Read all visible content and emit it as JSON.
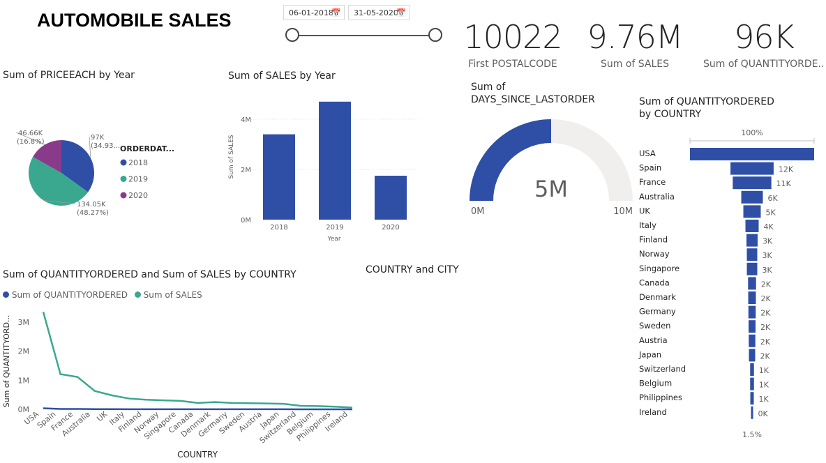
{
  "title": "AUTOMOBILE SALES",
  "date_filter": {
    "start": "06-01-2018",
    "end": "31-05-2020",
    "calendar_icon": "calendar-icon"
  },
  "cards": [
    {
      "value": "10022",
      "label": "First POSTALCODE"
    },
    {
      "value": "9.76M",
      "label": "Sum of SALES"
    },
    {
      "value": "96K",
      "label": "Sum of QUANTITYORDE..."
    }
  ],
  "colors": {
    "blue": "#2f4fa6",
    "teal": "#3aa88f",
    "purple": "#8a3a8a",
    "gauge_bg": "#f0efee"
  },
  "texts": {
    "country_city_title": "COUNTRY and CITY"
  },
  "chart_data": [
    {
      "type": "pie",
      "title": "Sum of PRICEEACH by Year",
      "legend_title": "ORDERDAT...",
      "legend_position": "right",
      "slices": [
        {
          "name": "2018",
          "value": 97,
          "label": "97K",
          "pct_label": "(34.93...",
          "color": "#2f4fa6"
        },
        {
          "name": "2019",
          "value": 134.05,
          "label": "134.05K",
          "pct_label": "(48.27%)",
          "color": "#3aa88f"
        },
        {
          "name": "2020",
          "value": 46.66,
          "label": "46.66K",
          "pct_label": "(16.8%)",
          "color": "#8a3a8a"
        }
      ]
    },
    {
      "type": "bar",
      "title": "Sum of SALES by Year",
      "categories": [
        "2018",
        "2019",
        "2020"
      ],
      "values": [
        3.4,
        4.7,
        1.75
      ],
      "xlabel": "Year",
      "ylabel": "Sum of SALES",
      "yticks": [
        "0M",
        "2M",
        "4M"
      ],
      "ylim": [
        0,
        5
      ]
    },
    {
      "type": "gauge",
      "title": "Sum of DAYS_SINCE_LASTORDER",
      "value": 5,
      "value_label": "5M",
      "min_label": "0M",
      "max_label": "10M",
      "min": 0,
      "max": 10
    },
    {
      "type": "bar",
      "orientation": "horizontal-funnel",
      "title": "Sum of QUANTITYORDERED by COUNTRY",
      "top_label": "100%",
      "bottom_label": "1.5%",
      "categories": [
        "USA",
        "Spain",
        "France",
        "Australia",
        "UK",
        "Italy",
        "Finland",
        "Norway",
        "Singapore",
        "Canada",
        "Denmark",
        "Germany",
        "Sweden",
        "Austria",
        "Japan",
        "Switzerland",
        "Belgium",
        "Philippines",
        "Ireland"
      ],
      "values": [
        35.7,
        12.4,
        11.1,
        6.2,
        5.0,
        3.8,
        3.2,
        3.0,
        3.0,
        2.3,
        2.2,
        2.1,
        2.0,
        1.9,
        1.8,
        1.1,
        1.1,
        1.0,
        0.5
      ],
      "data_labels": [
        "",
        "12K",
        "11K",
        "6K",
        "5K",
        "4K",
        "3K",
        "3K",
        "3K",
        "2K",
        "2K",
        "2K",
        "2K",
        "2K",
        "2K",
        "1K",
        "1K",
        "1K",
        "0K"
      ]
    },
    {
      "type": "line",
      "title": "Sum of QUANTITYORDERED and Sum of SALES by COUNTRY",
      "xlabel": "COUNTRY",
      "ylabel": "Sum of QUANTITYORD...",
      "yticks": [
        "0M",
        "1M",
        "2M",
        "3M"
      ],
      "ylim": [
        0,
        3.5
      ],
      "legend_position": "top-left",
      "categories": [
        "USA",
        "Spain",
        "France",
        "Australia",
        "UK",
        "Italy",
        "Finland",
        "Norway",
        "Singapore",
        "Canada",
        "Denmark",
        "Germany",
        "Sweden",
        "Austria",
        "Japan",
        "Switzerland",
        "Belgium",
        "Philippines",
        "Ireland"
      ],
      "series": [
        {
          "name": "Sum of QUANTITYORDERED",
          "color": "#2f4fa6",
          "values": [
            0.036,
            0.012,
            0.011,
            0.006,
            0.005,
            0.004,
            0.003,
            0.003,
            0.003,
            0.002,
            0.002,
            0.002,
            0.002,
            0.002,
            0.002,
            0.001,
            0.001,
            0.001,
            0.0005
          ]
        },
        {
          "name": "Sum of SALES",
          "color": "#3aa88f",
          "values": [
            3.35,
            1.21,
            1.11,
            0.63,
            0.48,
            0.37,
            0.33,
            0.31,
            0.29,
            0.22,
            0.25,
            0.22,
            0.21,
            0.2,
            0.19,
            0.12,
            0.11,
            0.09,
            0.06
          ]
        }
      ]
    }
  ]
}
